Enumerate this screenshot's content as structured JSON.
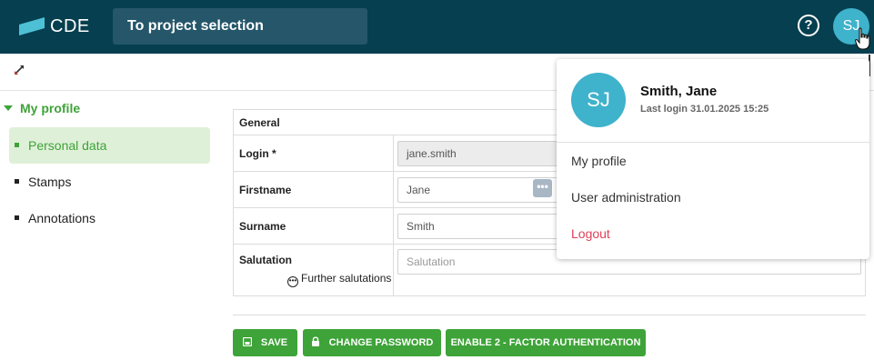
{
  "header": {
    "logo_text": "CDE",
    "project_button": "To project selection",
    "help_symbol": "?",
    "user_initials": "SJ",
    "colors": {
      "bar": "#063f4f",
      "avatar": "#3fb2cc",
      "accent": "#3ea338"
    }
  },
  "icons": {
    "logo": "logo-parallelogram",
    "help": "question-circle-icon",
    "collapse": "collapse-arrows-icon",
    "cursor": "hand-pointer-icon"
  },
  "sidebar": {
    "section_title": "My profile",
    "items": [
      {
        "label": "Personal data",
        "active": true
      },
      {
        "label": "Stamps",
        "active": false
      },
      {
        "label": "Annotations",
        "active": false
      }
    ]
  },
  "form": {
    "section_title": "General",
    "fields": [
      {
        "label": "Login *",
        "value": "jane.smith",
        "disabled": true
      },
      {
        "label": "Firstname",
        "value": "Jane"
      },
      {
        "label": "Surname",
        "value": "Smith"
      },
      {
        "label": "Salutation",
        "placeholder": "Salutation"
      }
    ],
    "further_salutations": "Further salutations",
    "dots_symbol": "•••"
  },
  "actions": {
    "save": "SAVE",
    "change_password": "CHANGE PASSWORD",
    "enable_2fa": "ENABLE 2 - FACTOR AUTHENTICATION"
  },
  "user_menu": {
    "initials": "SJ",
    "name": "Smith, Jane",
    "last_login": "Last login 31.01.2025 15:25",
    "items": [
      "My profile",
      "User administration",
      "Logout"
    ]
  }
}
